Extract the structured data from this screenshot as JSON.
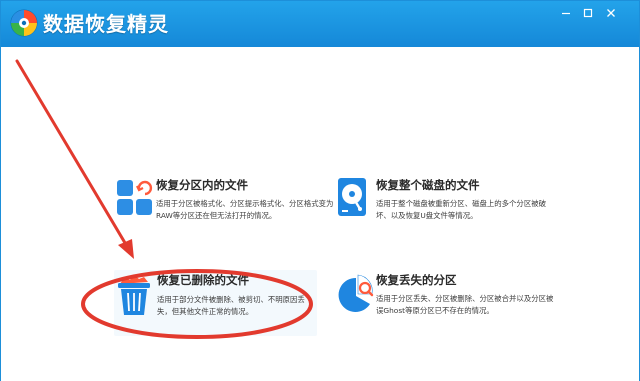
{
  "app": {
    "title": "数据恢复精灵"
  },
  "window_controls": {
    "minimize_icon": "minimize-icon",
    "maximize_icon": "maximize-icon",
    "close_icon": "close-icon"
  },
  "colors": {
    "titlebar": "#1a95df",
    "accent_blue": "#1a8fe3",
    "annotation_red": "#e23a2e"
  },
  "options": [
    {
      "title": "恢复分区内的文件",
      "desc": "适用于分区被格式化、分区提示格式化、分区格式变为RAW等分区还在但无法打开的情况。",
      "icon": "partition-files-icon"
    },
    {
      "title": "恢复整个磁盘的文件",
      "desc": "适用于整个磁盘被重新分区、磁盘上的多个分区被破坏、以及恢复U盘文件等情况。",
      "icon": "disk-icon"
    },
    {
      "title": "恢复已删除的文件",
      "desc": "适用于部分文件被删除、被剪切、不明原因丢失，但其他文件正常的情况。",
      "icon": "recycle-bin-icon"
    },
    {
      "title": "恢复丢失的分区",
      "desc": "适用于分区丢失、分区被删除、分区被合并以及分区被误Ghost等原分区已不存在的情况。",
      "icon": "lost-partition-icon"
    }
  ]
}
